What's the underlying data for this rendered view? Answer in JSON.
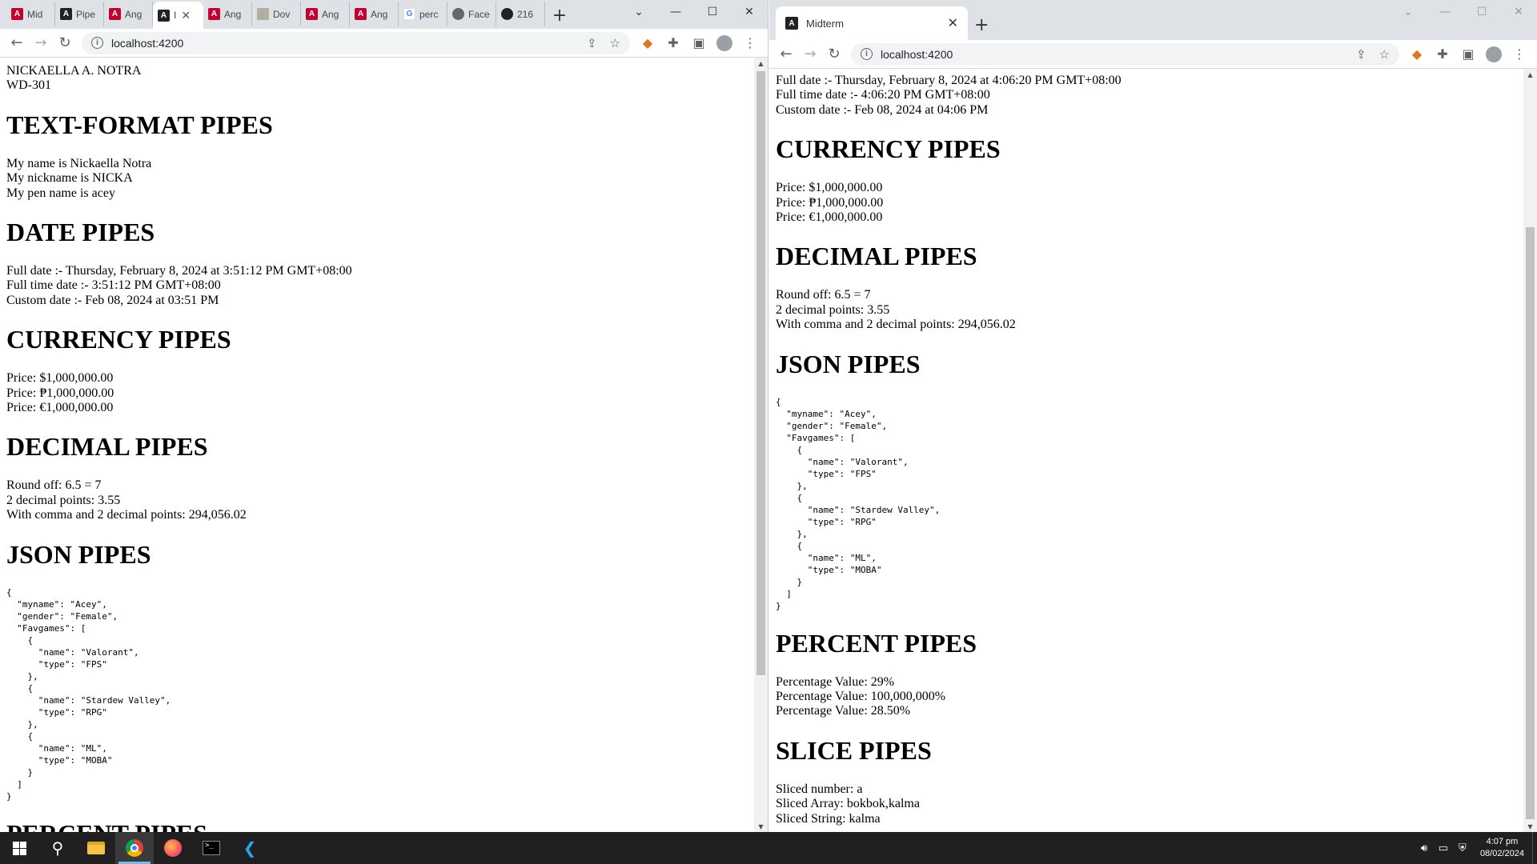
{
  "left_window": {
    "tabs": [
      {
        "label": "Mid",
        "icon": "red"
      },
      {
        "label": "Pipe",
        "icon": "dark"
      },
      {
        "label": "Ang",
        "icon": "red"
      },
      {
        "label": "I",
        "icon": "dark",
        "active": true
      },
      {
        "label": "Ang",
        "icon": "red"
      },
      {
        "label": "Dov",
        "icon": "gray"
      },
      {
        "label": "Ang",
        "icon": "red"
      },
      {
        "label": "Ang",
        "icon": "red"
      },
      {
        "label": "perc",
        "icon": "google"
      },
      {
        "label": "Face",
        "icon": "globe"
      },
      {
        "label": "216",
        "icon": "github"
      }
    ],
    "url": "localhost:4200",
    "header_lines": [
      "NICKAELLA A. NOTRA",
      "WD-301"
    ],
    "sections": [
      {
        "heading": "TEXT-FORMAT PIPES",
        "lines": [
          "My name is Nickaella Notra",
          "My nickname is NICKA",
          "My pen name is acey"
        ]
      },
      {
        "heading": "DATE PIPES",
        "lines": [
          "Full date :- Thursday, February 8, 2024 at 3:51:12 PM GMT+08:00",
          "Full time date :- 3:51:12 PM GMT+08:00",
          "Custom date :- Feb 08, 2024 at 03:51 PM"
        ]
      },
      {
        "heading": "CURRENCY PIPES",
        "lines": [
          "Price: $1,000,000.00",
          "Price: ₱1,000,000.00",
          "Price: €1,000,000.00"
        ]
      },
      {
        "heading": "DECIMAL PIPES",
        "lines": [
          "Round off: 6.5 = 7",
          "2 decimal points: 3.55",
          "With comma and 2 decimal points: 294,056.02"
        ]
      },
      {
        "heading": "JSON PIPES",
        "lines": []
      }
    ],
    "json_block": "{\n  \"myname\": \"Acey\",\n  \"gender\": \"Female\",\n  \"Favgames\": [\n    {\n      \"name\": \"Valorant\",\n      \"type\": \"FPS\"\n    },\n    {\n      \"name\": \"Stardew Valley\",\n      \"type\": \"RPG\"\n    },\n    {\n      \"name\": \"ML\",\n      \"type\": \"MOBA\"\n    }\n  ]\n}",
    "cut_heading": "PERCENT PIPES"
  },
  "right_window": {
    "tab_title": "Midterm",
    "url": "localhost:4200",
    "date_lines": [
      "Full date :- Thursday, February 8, 2024 at 4:06:20 PM GMT+08:00",
      "Full time date :- 4:06:20 PM GMT+08:00",
      "Custom date :- Feb 08, 2024 at 04:06 PM"
    ],
    "sections": [
      {
        "heading": "CURRENCY PIPES",
        "lines": [
          "Price: $1,000,000.00",
          "Price: ₱1,000,000.00",
          "Price: €1,000,000.00"
        ]
      },
      {
        "heading": "DECIMAL PIPES",
        "lines": [
          "Round off: 6.5 = 7",
          "2 decimal points: 3.55",
          "With comma and 2 decimal points: 294,056.02"
        ]
      },
      {
        "heading": "JSON PIPES",
        "lines": []
      }
    ],
    "json_block": "{\n  \"myname\": \"Acey\",\n  \"gender\": \"Female\",\n  \"Favgames\": [\n    {\n      \"name\": \"Valorant\",\n      \"type\": \"FPS\"\n    },\n    {\n      \"name\": \"Stardew Valley\",\n      \"type\": \"RPG\"\n    },\n    {\n      \"name\": \"ML\",\n      \"type\": \"MOBA\"\n    }\n  ]\n}",
    "after_sections": [
      {
        "heading": "PERCENT PIPES",
        "lines": [
          "Percentage Value: 29%",
          "Percentage Value: 100,000,000%",
          "Percentage Value: 28.50%"
        ]
      },
      {
        "heading": "SLICE PIPES",
        "lines": [
          "Sliced number: a",
          "Sliced Array: bokbok,kalma",
          "Sliced String: kalma"
        ]
      }
    ]
  },
  "taskbar": {
    "apps": [
      "start-icon",
      "search-icon",
      "file-explorer-icon",
      "chrome-icon",
      "firefox-icon",
      "terminal-icon",
      "vscode-icon"
    ],
    "time": "4:07 pm",
    "date": "08/02/2024"
  },
  "colors": {
    "tabstrip": "#dee1e6",
    "taskbar": "#202020",
    "accent": "#76b9ed"
  }
}
